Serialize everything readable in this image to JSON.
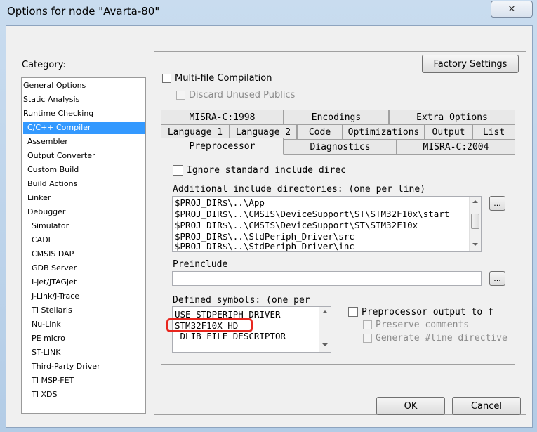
{
  "window": {
    "title": "Options for node \"Avarta-80\"",
    "close_glyph": "✕"
  },
  "category": {
    "label": "Category:",
    "items": [
      "General Options",
      "Static Analysis",
      "Runtime Checking",
      "C/C++ Compiler",
      "Assembler",
      "Output Converter",
      "Custom Build",
      "Build Actions",
      "Linker",
      "Debugger",
      "Simulator",
      "CADI",
      "CMSIS DAP",
      "GDB Server",
      "I-jet/JTAGjet",
      "J-Link/J-Trace",
      "TI Stellaris",
      "Nu-Link",
      "PE micro",
      "ST-LINK",
      "Third-Party Driver",
      "TI MSP-FET",
      "TI XDS"
    ],
    "selected": "C/C++ Compiler"
  },
  "panel": {
    "factory_settings": "Factory Settings",
    "multifile": "Multi-file Compilation",
    "discard": "Discard Unused Publics",
    "tabs_row1": [
      "MISRA-C:1998",
      "Encodings",
      "Extra Options"
    ],
    "tabs_row2": [
      "Language 1",
      "Language 2",
      "Code",
      "Optimizations",
      "Output",
      "List"
    ],
    "tabs_row3": [
      "Preprocessor",
      "Diagnostics",
      "MISRA-C:2004"
    ],
    "active_tab": "Preprocessor"
  },
  "preprocessor": {
    "ignore_std": "Ignore standard include direc",
    "include_dirs_label": "Additional include directories: (one per line)",
    "include_dirs": [
      "$PROJ_DIR$\\..\\App",
      "$PROJ_DIR$\\..\\CMSIS\\DeviceSupport\\ST\\STM32F10x\\start",
      "$PROJ_DIR$\\..\\CMSIS\\DeviceSupport\\ST\\STM32F10x",
      "$PROJ_DIR$\\..\\StdPeriph_Driver\\src",
      "$PROJ_DIR$\\..\\StdPeriph_Driver\\inc"
    ],
    "browse": "...",
    "preinclude_label": "Preinclude",
    "preinclude_value": "",
    "defined_label": "Defined symbols: (one per",
    "defined_symbols": [
      "USE_STDPERIPH_DRIVER",
      "STM32F10X_HD",
      "_DLIB_FILE_DESCRIPTOR"
    ],
    "preproc_output": "Preprocessor output to f",
    "preserve_comments": "Preserve comments",
    "generate_line": "Generate #line directive"
  },
  "buttons": {
    "ok": "OK",
    "cancel": "Cancel"
  }
}
